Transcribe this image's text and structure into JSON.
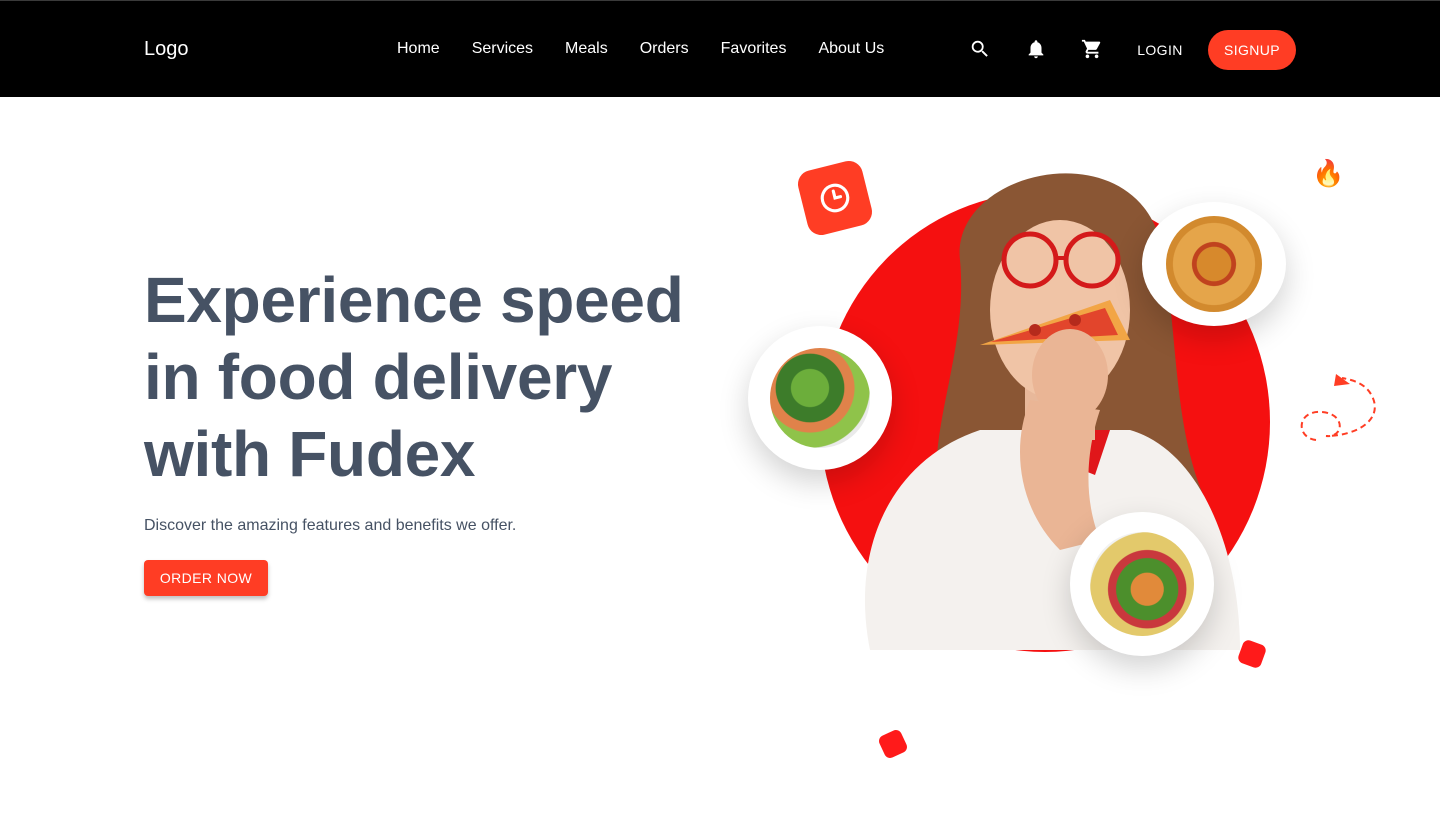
{
  "header": {
    "logo": "Logo",
    "nav": [
      "Home",
      "Services",
      "Meals",
      "Orders",
      "Favorites",
      "About Us"
    ],
    "icons": [
      "search-icon",
      "bell-icon",
      "cart-icon"
    ],
    "login_label": "LOGIN",
    "signup_label": "SIGNUP"
  },
  "hero": {
    "title": "Experience speed in food delivery with Fudex",
    "subtitle": "Discover the amazing features and benefits we offer.",
    "cta_label": "ORDER NOW"
  },
  "decorations": {
    "fire": "🔥",
    "clock": "clock-icon"
  },
  "colors": {
    "accent": "#ff3d24",
    "navbar_bg": "#000000",
    "heading_text": "#465264",
    "circle_red": "#f51010"
  }
}
